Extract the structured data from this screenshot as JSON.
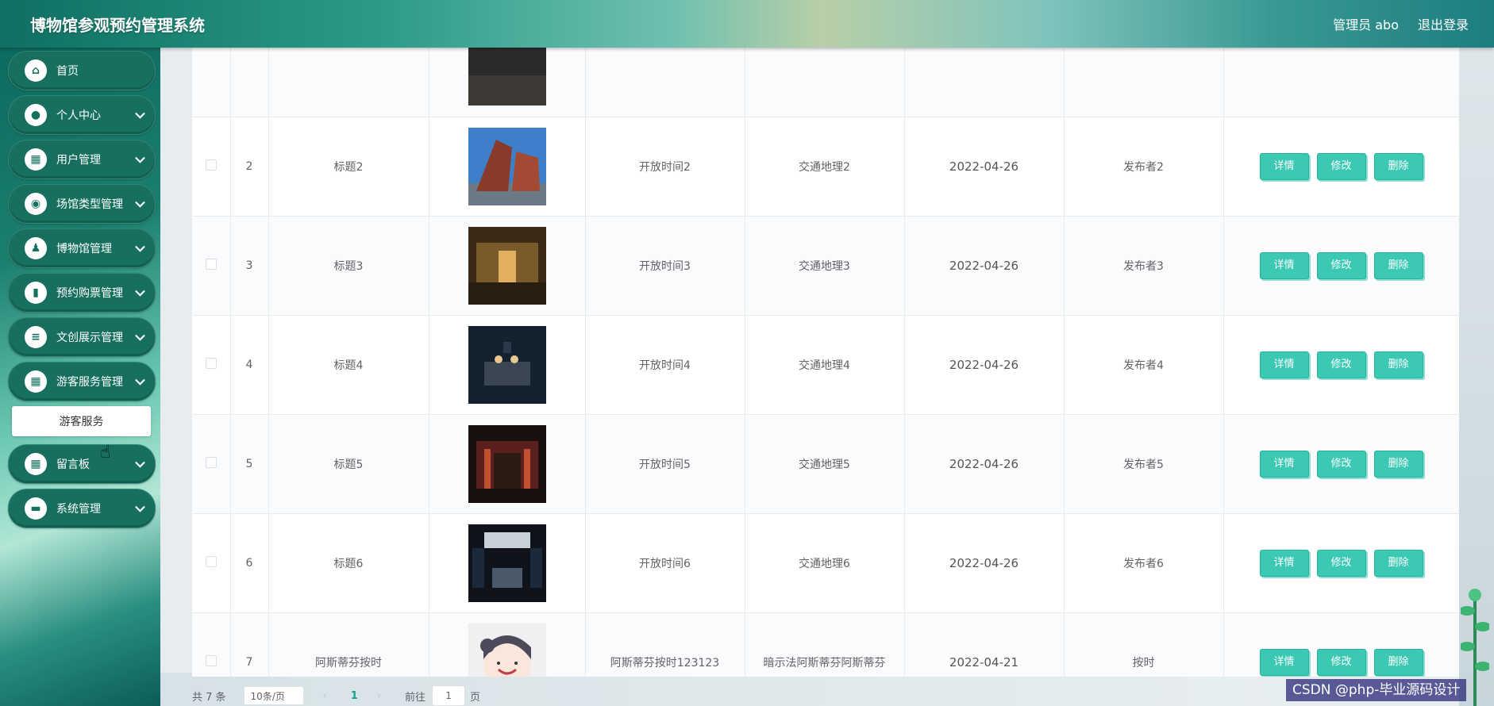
{
  "header": {
    "title": "博物馆参观预约管理系统",
    "user": "管理员 abo",
    "logout": "退出登录"
  },
  "sidebar": {
    "items": [
      {
        "label": "首页",
        "icon": "home-icon",
        "glyph": "⌂",
        "chevron": false
      },
      {
        "label": "个人中心",
        "icon": "user-icon",
        "glyph": "●",
        "chevron": true
      },
      {
        "label": "用户管理",
        "icon": "grid-icon",
        "glyph": "▦",
        "chevron": true
      },
      {
        "label": "场馆类型管理",
        "icon": "location-icon",
        "glyph": "◉",
        "chevron": true
      },
      {
        "label": "博物馆管理",
        "icon": "stamp-icon",
        "glyph": "♟",
        "chevron": true
      },
      {
        "label": "预约购票管理",
        "icon": "book-icon",
        "glyph": "▮",
        "chevron": true
      },
      {
        "label": "文创展示管理",
        "icon": "list-icon",
        "glyph": "≡",
        "chevron": true
      },
      {
        "label": "游客服务管理",
        "icon": "grid-icon",
        "glyph": "▦",
        "chevron": true
      },
      {
        "label": "留言板",
        "icon": "grid-icon",
        "glyph": "▦",
        "chevron": true
      },
      {
        "label": "系统管理",
        "icon": "monitor-icon",
        "glyph": "▬",
        "chevron": true
      }
    ],
    "submenu_label": "游客服务"
  },
  "table": {
    "rows": [
      {
        "index": "",
        "title": "",
        "open_time": "",
        "traffic": "",
        "date": "",
        "publisher": "",
        "partial": true,
        "img": "dark"
      },
      {
        "index": "2",
        "title": "标题2",
        "open_time": "开放时间2",
        "traffic": "交通地理2",
        "date": "2022-04-26",
        "publisher": "发布者2",
        "img": "building"
      },
      {
        "index": "3",
        "title": "标题3",
        "open_time": "开放时间3",
        "traffic": "交通地理3",
        "date": "2022-04-26",
        "publisher": "发布者3",
        "img": "hall"
      },
      {
        "index": "4",
        "title": "标题4",
        "open_time": "开放时间4",
        "traffic": "交通地理4",
        "date": "2022-04-26",
        "publisher": "发布者4",
        "img": "exhibit"
      },
      {
        "index": "5",
        "title": "标题5",
        "open_time": "开放时间5",
        "traffic": "交通地理5",
        "date": "2022-04-26",
        "publisher": "发布者5",
        "img": "red"
      },
      {
        "index": "6",
        "title": "标题6",
        "open_time": "开放时间6",
        "traffic": "交通地理6",
        "date": "2022-04-26",
        "publisher": "发布者6",
        "img": "gallery"
      },
      {
        "index": "7",
        "title": "阿斯蒂芬按时",
        "open_time": "阿斯蒂芬按时123123",
        "traffic": "暗示法阿斯蒂芬阿斯蒂芬",
        "date": "2022-04-21",
        "publisher": "按时",
        "img": "cartoon"
      }
    ],
    "actions": {
      "detail": "详情",
      "edit": "修改",
      "delete": "删除"
    }
  },
  "pagination": {
    "total": "共 7 条",
    "page_size": "10条/页",
    "current": "1",
    "goto_prefix": "前往",
    "goto_value": "1",
    "goto_suffix": "页"
  },
  "watermark": "CSDN @php-毕业源码设计",
  "colors": {
    "accent": "#3cc9b4",
    "sidebar": "#17705f"
  }
}
